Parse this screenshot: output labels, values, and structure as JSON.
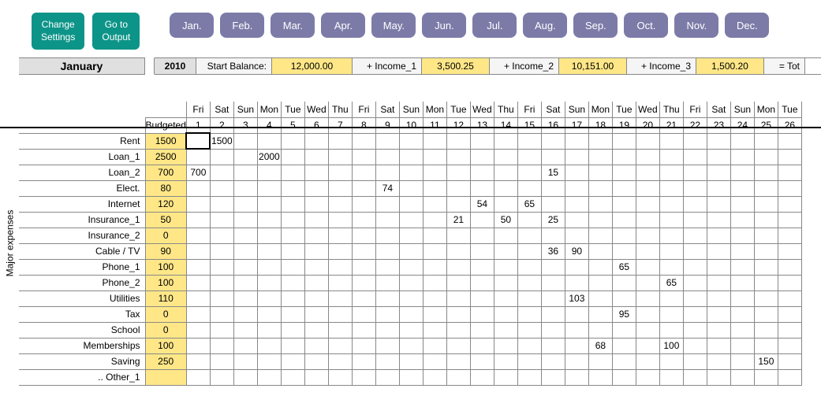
{
  "buttons": {
    "change_settings": "Change\nSettings",
    "goto_output": "Go to\nOutput"
  },
  "months": [
    "Jan.",
    "Feb.",
    "Mar.",
    "Apr.",
    "May.",
    "Jun.",
    "Jul.",
    "Aug.",
    "Sep.",
    "Oct.",
    "Nov.",
    "Dec."
  ],
  "header": {
    "month": "January",
    "year": "2010",
    "start_balance_label": "Start Balance:",
    "start_balance": "12,000.00",
    "income1_label": "+ Income_1",
    "income1": "3,500.25",
    "income2_label": "+ Income_2",
    "income2": "10,151.00",
    "income3_label": "+ Income_3",
    "income3": "1,500.20",
    "total_label": "= Tot"
  },
  "side_label": "Major expenses",
  "budgeted_label": "Budgeted",
  "dow": [
    "Fri",
    "Sat",
    "Sun",
    "Mon",
    "Tue",
    "Wed",
    "Thu",
    "Fri",
    "Sat",
    "Sun",
    "Mon",
    "Tue",
    "Wed",
    "Thu",
    "Fri",
    "Sat",
    "Sun",
    "Mon",
    "Tue",
    "Wed",
    "Thu",
    "Fri",
    "Sat",
    "Sun",
    "Mon",
    "Tue"
  ],
  "days": [
    "1",
    "2",
    "3",
    "4",
    "5",
    "6",
    "7",
    "8",
    "9",
    "10",
    "11",
    "12",
    "13",
    "14",
    "15",
    "16",
    "17",
    "18",
    "19",
    "20",
    "21",
    "22",
    "23",
    "24",
    "25",
    "26"
  ],
  "rows": [
    {
      "label": "Rent",
      "budget": "1500",
      "cells": {
        "2": "1500"
      }
    },
    {
      "label": "Loan_1",
      "budget": "2500",
      "cells": {
        "4": "2000"
      }
    },
    {
      "label": "Loan_2",
      "budget": "700",
      "cells": {
        "1": "700",
        "16": "15"
      }
    },
    {
      "label": "Elect.",
      "budget": "80",
      "cells": {
        "9": "74"
      }
    },
    {
      "label": "Internet",
      "budget": "120",
      "cells": {
        "13": "54",
        "15": "65"
      }
    },
    {
      "label": "Insurance_1",
      "budget": "50",
      "cells": {
        "12": "21",
        "14": "50",
        "16": "25"
      }
    },
    {
      "label": "Insurance_2",
      "budget": "0",
      "cells": {}
    },
    {
      "label": "Cable / TV",
      "budget": "90",
      "cells": {
        "16": "36",
        "17": "90"
      }
    },
    {
      "label": "Phone_1",
      "budget": "100",
      "cells": {
        "19": "65"
      }
    },
    {
      "label": "Phone_2",
      "budget": "100",
      "cells": {
        "21": "65"
      }
    },
    {
      "label": "Utilities",
      "budget": "110",
      "cells": {
        "17": "103"
      }
    },
    {
      "label": "Tax",
      "budget": "0",
      "cells": {
        "19": "95"
      }
    },
    {
      "label": "School",
      "budget": "0",
      "cells": {}
    },
    {
      "label": "Memberships",
      "budget": "100",
      "cells": {
        "18": "68",
        "21": "100"
      }
    },
    {
      "label": "Saving",
      "budget": "250",
      "cells": {
        "25": "150"
      }
    },
    {
      "label": ".. Other_1",
      "budget": "",
      "cells": {}
    }
  ]
}
